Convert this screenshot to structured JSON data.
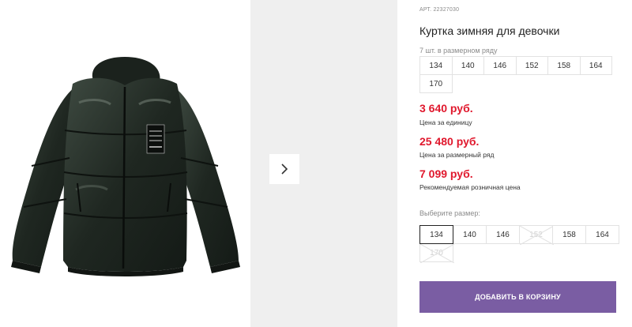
{
  "product": {
    "article_label": "АРТ.",
    "article_number": "22327030",
    "title": "Куртка зимняя для девочки",
    "row_note": "7 шт. в размерном ряду",
    "row_sizes": [
      "134",
      "140",
      "146",
      "152",
      "158",
      "164",
      "170"
    ]
  },
  "prices": [
    {
      "value": "3 640 руб.",
      "label": "Цена за единицу"
    },
    {
      "value": "25 480 руб.",
      "label": "Цена за размерный ряд"
    },
    {
      "value": "7 099 руб.",
      "label": "Рекомендуемая розничная цена"
    }
  ],
  "size_picker": {
    "label": "Выберите размер:",
    "options": [
      {
        "size": "134",
        "state": "selected"
      },
      {
        "size": "140",
        "state": "available"
      },
      {
        "size": "146",
        "state": "available"
      },
      {
        "size": "152",
        "state": "disabled"
      },
      {
        "size": "158",
        "state": "available"
      },
      {
        "size": "164",
        "state": "available"
      },
      {
        "size": "170",
        "state": "disabled"
      }
    ]
  },
  "cart_button_label": "ДОБАВИТЬ В КОРЗИНУ",
  "icons": {
    "next": "chevron-right-icon"
  },
  "colors": {
    "price_red": "#e0182d",
    "button_purple": "#7a5da3",
    "gallery_bg": "#efefef"
  }
}
